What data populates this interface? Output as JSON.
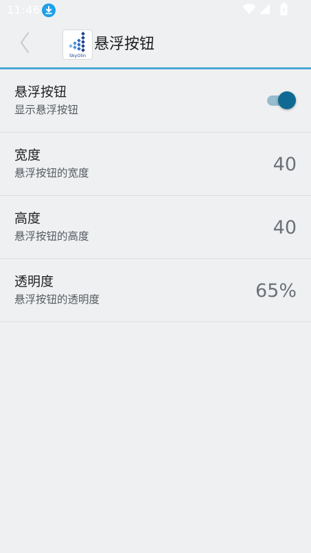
{
  "status_bar": {
    "time": "11:46"
  },
  "app_bar": {
    "title": "悬浮按钮",
    "logo_text": "SkyOlin"
  },
  "settings": [
    {
      "title": "悬浮按钮",
      "summary": "显示悬浮按钮",
      "type": "toggle",
      "enabled": true
    },
    {
      "title": "宽度",
      "summary": "悬浮按钮的宽度",
      "type": "value",
      "value": "40"
    },
    {
      "title": "高度",
      "summary": "悬浮按钮的高度",
      "type": "value",
      "value": "40"
    },
    {
      "title": "透明度",
      "summary": "悬浮按钮的透明度",
      "type": "value",
      "value": "65%"
    }
  ],
  "colors": {
    "background": "#eff0f2",
    "accent": "#4aa8d8",
    "toggle_on": "#0f6a93",
    "toggle_track": "#95bccf",
    "download_badge": "#1ea0e8"
  },
  "icons": {
    "back": "chevron-left-icon",
    "download": "download-icon",
    "wifi": "wifi-icon",
    "cellular": "cellular-signal-icon",
    "battery": "battery-icon"
  }
}
